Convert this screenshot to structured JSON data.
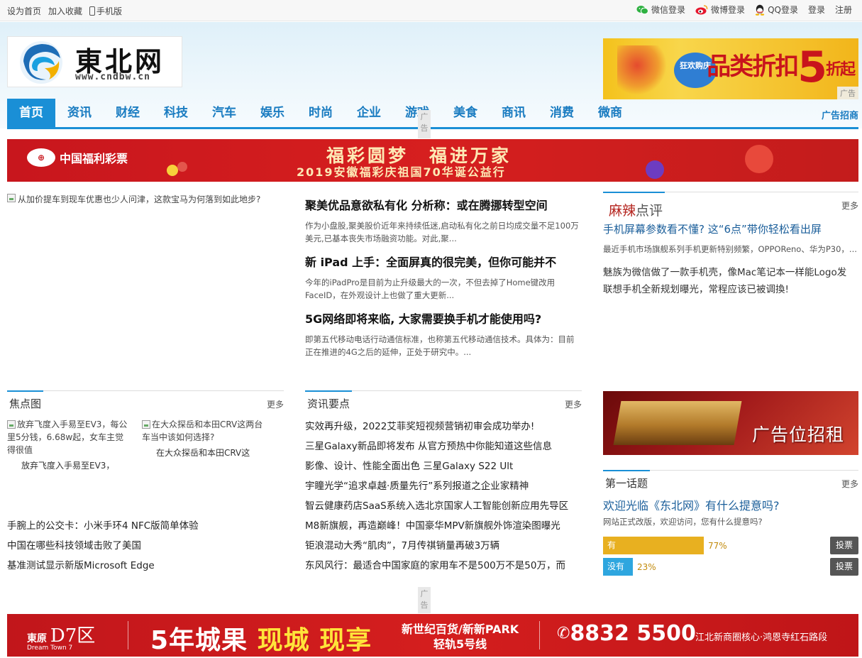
{
  "topbar": {
    "set_home": "设为首页",
    "add_fav": "加入收藏",
    "mobile": "手机版",
    "wechat_login": "微信登录",
    "weibo_login": "微博登录",
    "qq_login": "QQ登录",
    "login": "登录",
    "register": "注册"
  },
  "logo": {
    "brand": "東北网",
    "url": "www.cndbw.cn"
  },
  "top_ad": {
    "text": "品类折扣",
    "big_number": "5",
    "suffix": "折起",
    "badge": "狂欢购庆",
    "ad_tag": "广告"
  },
  "nav": {
    "items": [
      "首页",
      "资讯",
      "财经",
      "科技",
      "汽车",
      "娱乐",
      "时尚",
      "企业",
      "游戏",
      "美食",
      "商讯",
      "消费",
      "微商"
    ],
    "active_index": 0,
    "ad_call": "广告招商",
    "ad_label": "广告"
  },
  "banner1": {
    "org": "中国福利彩票",
    "title": "福彩圆梦　福进万家",
    "subtitle": "2019安徽福彩庆祖国70华诞公益行"
  },
  "lead_image_alt": "从加价提车到现车优惠也少人问津，这款宝马为何落到如此地步?",
  "articles": [
    {
      "title": "聚美优品意欲私有化 分析称：或在腾挪转型空间",
      "summary": "作为小盘股,聚美股价近年来持续低迷,启动私有化之前日均成交量不足100万美元,已基本丧失市场融资功能。对此,聚..."
    },
    {
      "title": "新 iPad 上手：全面屏真的很完美，但你可能并不",
      "summary": "今年的iPadPro是目前为止升级最大的一次，不但去掉了Home键改用FaceID，在外观设计上也做了重大更新..."
    },
    {
      "title": "5G网络即将来临, 大家需要换手机才能使用吗?",
      "summary": "即第五代移动电话行动通信标准，也称第五代移动通信技术。具体为：目前正在推进的4G之后的延伸，正处于研究中。..."
    }
  ],
  "review": {
    "title_a": "麻辣",
    "title_b": "点评",
    "more": "更多",
    "headline": "手机屏幕参数看不懂? 这“6点”带你轻松看出屏",
    "desc": "最近手机市场旗舰系列手机更新特别频繁，OPPOReno、华为P30，...",
    "links": [
      "魅族为微信做了一款手机壳，像Mac笔记本一样能Logo发",
      "联想手机全新规划曝光，常程应该已被调換!"
    ]
  },
  "focus": {
    "title": "焦点图",
    "more": "更多",
    "items": [
      {
        "alt": "放弃飞度入手易至EV3，每公里5分钱，6.68w起，女车主觉得很值",
        "caption": "放弃飞度入手易至EV3，"
      },
      {
        "alt": "在大众探岳和本田CRV这两台车当中该如何选择?",
        "caption": "在大众探岳和本田CRV这"
      }
    ],
    "links": [
      "手腕上的公交卡：小米手环4 NFC版简单体验",
      "中国在哪些科技领域击败了美国",
      "基准测试显示新版Microsoft Edge"
    ]
  },
  "news": {
    "title": "资讯要点",
    "more": "更多",
    "links": [
      "实效再升级，2022艾菲奖短视频营销初审会成功举办!",
      "三星Galaxy新品即将发布 从官方预热中你能知道这些信息",
      "影像、设计、性能全面出色 三星Galaxy S22 Ult",
      "宇瞳光学“追求卓越·质量先行”系列报道之企业家精神",
      "智云健康药店SaaS系统入选北京国家人工智能创新应用先导区",
      "M8新旗舰，再造巅峰！中国豪华MPV新旗舰外饰渲染图曝光",
      "钜浪混动大秀“肌肉”，7月传祺销量再破3万辆",
      "东风风行：最适合中国家庭的家用车不是500万不是50万，而"
    ]
  },
  "ad_box": {
    "text": "广告位招租"
  },
  "poll": {
    "section": "第一话题",
    "more": "更多",
    "question": "欢迎光临《东北网》有什么提意吗?",
    "desc": "网站正式改版，欢迎访问，您有什么提意吗?",
    "options": [
      {
        "label": "有",
        "percent": 77,
        "percent_text": "77%",
        "color": "#e8b020",
        "vote": "投票"
      },
      {
        "label": "没有",
        "percent": 23,
        "percent_text": "23%",
        "color": "#2ea6df",
        "vote": "投票"
      }
    ]
  },
  "banner2": {
    "brand": "東原",
    "brand_big": "D7区",
    "brand_en": "Dream Town 7",
    "slogan_a": "5年城果",
    "slogan_b": "现城 现享",
    "mid_1": "新世纪百货/新新PARK",
    "mid_2": "轻轨5号线",
    "tel": "8832 5500",
    "addr": "江北新商圈核心·鸿恩寺红石路段",
    "ad_label": "广告"
  }
}
